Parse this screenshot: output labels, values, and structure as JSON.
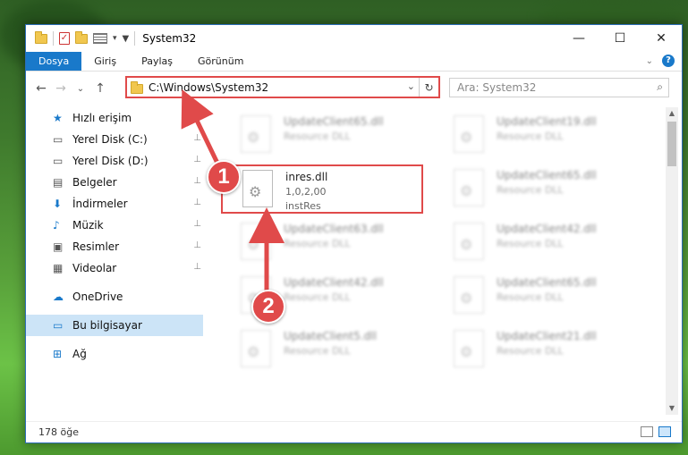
{
  "window": {
    "title": "System32",
    "controls": {
      "minimize": "—",
      "maximize": "☐",
      "close": "✕"
    }
  },
  "ribbon": {
    "tabs": [
      "Dosya",
      "Giriş",
      "Paylaş",
      "Görünüm"
    ],
    "active_tab": "Dosya",
    "help": "?"
  },
  "nav": {
    "back": "←",
    "forward": "→",
    "recent": "⌄",
    "up": "↑"
  },
  "address": {
    "path": "C:\\Windows\\System32",
    "dropdown": "⌄",
    "refresh": "↻"
  },
  "search": {
    "placeholder": "Ara: System32",
    "icon": "search-icon"
  },
  "sidebar": {
    "items": [
      {
        "label": "Hızlı erişim",
        "icon": "star-icon",
        "pinned": false
      },
      {
        "label": "Yerel Disk (C:)",
        "icon": "drive-icon",
        "pinned": true
      },
      {
        "label": "Yerel Disk (D:)",
        "icon": "drive-icon",
        "pinned": true
      },
      {
        "label": "Belgeler",
        "icon": "documents-icon",
        "pinned": true
      },
      {
        "label": "İndirmeler",
        "icon": "download-icon",
        "pinned": true
      },
      {
        "label": "Müzik",
        "icon": "music-icon",
        "pinned": true
      },
      {
        "label": "Resimler",
        "icon": "pictures-icon",
        "pinned": true
      },
      {
        "label": "Videolar",
        "icon": "video-icon",
        "pinned": true
      },
      {
        "label": "OneDrive",
        "icon": "onedrive-icon",
        "pinned": false
      },
      {
        "label": "Bu bilgisayar",
        "icon": "computer-icon",
        "pinned": false,
        "selected": true
      },
      {
        "label": "Ağ",
        "icon": "network-icon",
        "pinned": false
      }
    ],
    "pin_glyph": "📌"
  },
  "files": [
    {
      "name": "UpdateClient65.dll",
      "line2": "Resource DLL",
      "line3": ""
    },
    {
      "name": "UpdateClient19.dll",
      "line2": "Resource DLL",
      "line3": ""
    },
    {
      "name": "inres.dll",
      "line2": "1,0,2,00",
      "line3": "instRes",
      "highlighted": true
    },
    {
      "name": "UpdateClient65.dll",
      "line2": "Resource DLL",
      "line3": ""
    },
    {
      "name": "UpdateClient63.dll",
      "line2": "Resource DLL",
      "line3": ""
    },
    {
      "name": "UpdateClient42.dll",
      "line2": "Resource DLL",
      "line3": ""
    },
    {
      "name": "UpdateClient42.dll",
      "line2": "Resource DLL",
      "line3": ""
    },
    {
      "name": "UpdateClient65.dll",
      "line2": "Resource DLL",
      "line3": ""
    },
    {
      "name": "UpdateClient5.dll",
      "line2": "Resource DLL",
      "line3": ""
    },
    {
      "name": "UpdateClient21.dll",
      "line2": "Resource DLL",
      "line3": ""
    }
  ],
  "status": {
    "count": "178 öğe"
  },
  "annotations": {
    "step1": "1",
    "step2": "2",
    "accent": "#e04a4a"
  },
  "colors": {
    "ribbon_file_tab": "#1979ca",
    "selection": "#cce4f7",
    "highlight": "#e04a4a"
  }
}
